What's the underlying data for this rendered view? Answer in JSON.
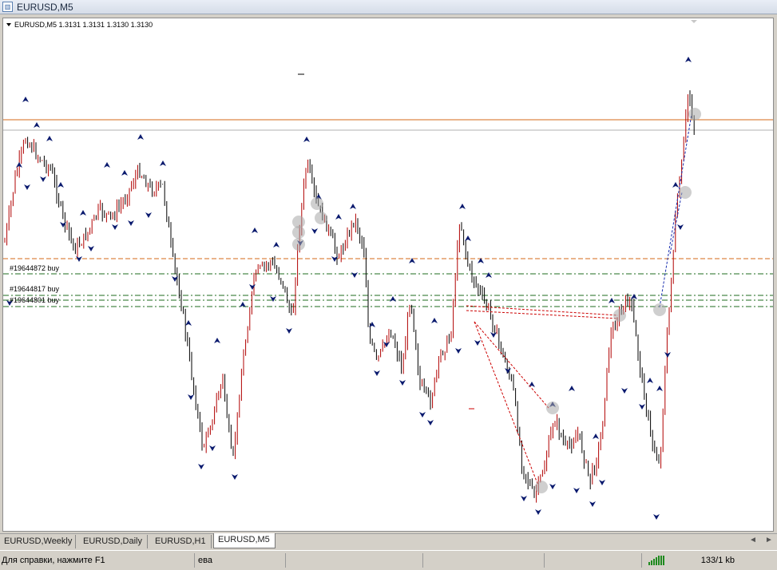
{
  "window": {
    "title": "EURUSD,M5",
    "icon": "chart-window-icon"
  },
  "chart": {
    "symbol_info": "EURUSD,M5  1.3131 1.3131 1.3130 1.3130",
    "colors": {
      "background": "#ffffff",
      "bull_candle": "#b00000",
      "bear_candle": "#000000",
      "fractal_arrow": "#0a1a6e",
      "orange_line": "#d66a1a",
      "gray_line": "#b0b0b0",
      "order_line": "#1d6b1d",
      "trend_line": "#cc0000",
      "blue_trend": "#1a2fb0",
      "marker_circle": "#a8a8a8"
    },
    "orders": [
      {
        "label": "#19644872 buy"
      },
      {
        "label": "#19644817 buy"
      },
      {
        "label": "#19644801 buy"
      }
    ]
  },
  "tabs": [
    {
      "label": "EURUSD,Weekly",
      "active": false
    },
    {
      "label": "EURUSD,Daily",
      "active": false
    },
    {
      "label": "EURUSD,H1",
      "active": false
    },
    {
      "label": "EURUSD,M5",
      "active": true
    }
  ],
  "tab_nav": {
    "left": "◄",
    "right": "►"
  },
  "status": {
    "help": "Для справки, нажмите F1",
    "profile": "ева",
    "traffic": "133/1 kb",
    "connection_icon": "connection-bars-icon"
  }
}
